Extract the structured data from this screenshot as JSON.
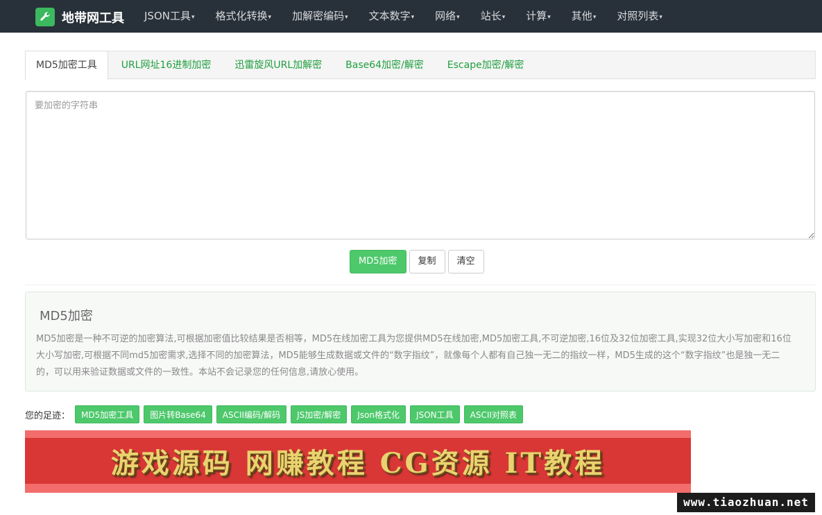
{
  "navbar": {
    "brand": "地带网工具",
    "items": [
      {
        "label": "JSON工具"
      },
      {
        "label": "格式化转换"
      },
      {
        "label": "加解密编码"
      },
      {
        "label": "文本数字"
      },
      {
        "label": "网络"
      },
      {
        "label": "站长"
      },
      {
        "label": "计算"
      },
      {
        "label": "其他"
      },
      {
        "label": "对照列表"
      }
    ],
    "caret": "▾"
  },
  "tabs": [
    {
      "label": "MD5加密工具",
      "active": true
    },
    {
      "label": "URL网址16进制加密"
    },
    {
      "label": "迅雷旋风URL加解密"
    },
    {
      "label": "Base64加密/解密"
    },
    {
      "label": "Escape加密/解密"
    }
  ],
  "input": {
    "placeholder": "要加密的字符串",
    "value": ""
  },
  "buttons": {
    "encrypt": "MD5加密",
    "copy": "复制",
    "clear": "清空"
  },
  "info": {
    "title": "MD5加密",
    "text": "MD5加密是一种不可逆的加密算法,可根据加密值比较结果是否相等，MD5在线加密工具为您提供MD5在线加密,MD5加密工具,不可逆加密,16位及32位加密工具,实现32位大小写加密和16位大小写加密,可根据不同md5加密需求,选择不同的加密算法，MD5能够生成数据或文件的“数字指纹”，就像每个人都有自己独一无二的指纹一样，MD5生成的这个“数字指纹”也是独一无二的，可以用来验证数据或文件的一致性。本站不会记录您的任何信息,请放心使用。"
  },
  "footprint": {
    "label": "您的足迹：",
    "tags": [
      {
        "label": "MD5加密工具"
      },
      {
        "label": "图片转Base64"
      },
      {
        "label": "ASCII编码/解码"
      },
      {
        "label": "JS加密/解密"
      },
      {
        "label": "Json格式化"
      },
      {
        "label": "JSON工具"
      },
      {
        "label": "ASCII对照表"
      }
    ]
  },
  "banner": {
    "text": "游戏源码 网赚教程 CG资源 IT教程"
  },
  "watermark": "www.tiaozhuan.net",
  "colors": {
    "navbar_bg": "#283039",
    "accent_green": "#4dc86b",
    "tab_link": "#1e9e3e",
    "banner_red": "#d93636"
  }
}
